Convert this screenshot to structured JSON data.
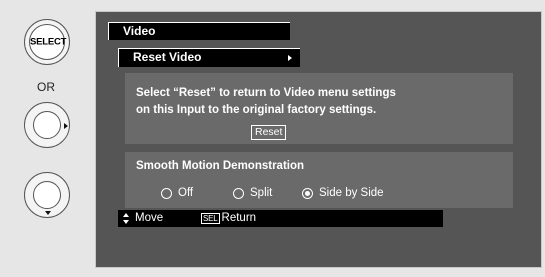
{
  "remote": {
    "select_label": "SELECT",
    "or_label": "OR"
  },
  "menu": {
    "tab_title": "Video",
    "item_label": "Reset Video"
  },
  "reset_panel": {
    "line1": "Select “Reset” to return to Video menu settings",
    "line2": "on this Input to the original factory settings.",
    "button_label": "Reset"
  },
  "motion_panel": {
    "title": "Smooth Motion Demonstration",
    "options": [
      {
        "label": "Off",
        "selected": false
      },
      {
        "label": "Split",
        "selected": false
      },
      {
        "label": "Side by Side",
        "selected": true
      }
    ]
  },
  "help_bar": {
    "move_label": "Move",
    "sel_badge": "SEL",
    "return_label": "Return"
  }
}
